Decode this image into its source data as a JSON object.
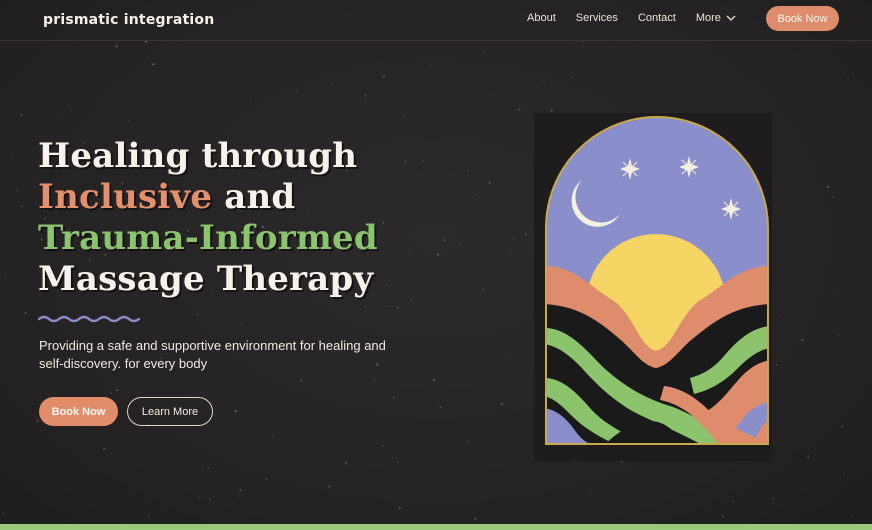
{
  "brand": {
    "logo_text": "prismatic integration"
  },
  "nav": {
    "items": [
      "About",
      "Services",
      "Contact"
    ],
    "more_label": "More",
    "book_label": "Book Now"
  },
  "hero": {
    "line1": "Healing through",
    "line2_accent": "Inclusive",
    "line2_rest": " and",
    "line3": "Trauma-Informed",
    "line4": "Massage Therapy",
    "description": "Providing a safe and supportive environment for healing and self-discovery. for every body",
    "primary_cta": "Book Now",
    "secondary_cta": "Learn More"
  },
  "icons": {
    "nav_more": "chevron-down-icon",
    "divider": "squiggle-icon",
    "artwork": "sunset-arch-illustration"
  },
  "colors": {
    "background": "#262424",
    "coral": "#e18c6b",
    "green": "#8cc46e",
    "periwinkle": "#8a8fcc",
    "sun": "#f4d563"
  }
}
